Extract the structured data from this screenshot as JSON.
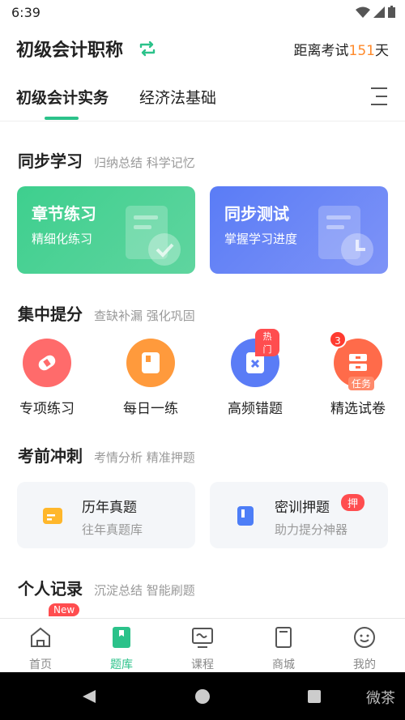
{
  "status_bar": {
    "time": "6:39"
  },
  "header": {
    "exam_title": "初级会计职称",
    "countdown_prefix": "距离考试",
    "countdown_days": "151",
    "countdown_suffix": "天"
  },
  "tabs": [
    {
      "label": "初级会计实务"
    },
    {
      "label": "经济法基础"
    }
  ],
  "sections": {
    "sync": {
      "title": "同步学习",
      "subtitle": "归纳总结 科学记忆",
      "cards": [
        {
          "title": "章节练习",
          "subtitle": "精细化练习"
        },
        {
          "title": "同步测试",
          "subtitle": "掌握学习进度"
        }
      ]
    },
    "focus": {
      "title": "集中提分",
      "subtitle": "查缺补漏 强化巩固",
      "items": [
        {
          "label": "专项练习"
        },
        {
          "label": "每日一练"
        },
        {
          "label": "高频错题",
          "badge": "热门"
        },
        {
          "label": "精选试卷",
          "count": "3",
          "tag": "任务"
        }
      ]
    },
    "sprint": {
      "title": "考前冲刺",
      "subtitle": "考情分析 精准押题",
      "cards": [
        {
          "title": "历年真题",
          "subtitle": "往年真题库"
        },
        {
          "title": "密训押题",
          "subtitle": "助力提分神器",
          "badge": "押"
        }
      ]
    },
    "record": {
      "title": "个人记录",
      "subtitle": "沉淀总结 智能刷题",
      "new_badge": "New"
    }
  },
  "bottom_nav": [
    {
      "label": "首页"
    },
    {
      "label": "题库"
    },
    {
      "label": "课程"
    },
    {
      "label": "商城"
    },
    {
      "label": "我的"
    }
  ],
  "watermark": "微茶",
  "colors": {
    "accent": "#2bc28a",
    "countdown": "#ff8a2b"
  }
}
